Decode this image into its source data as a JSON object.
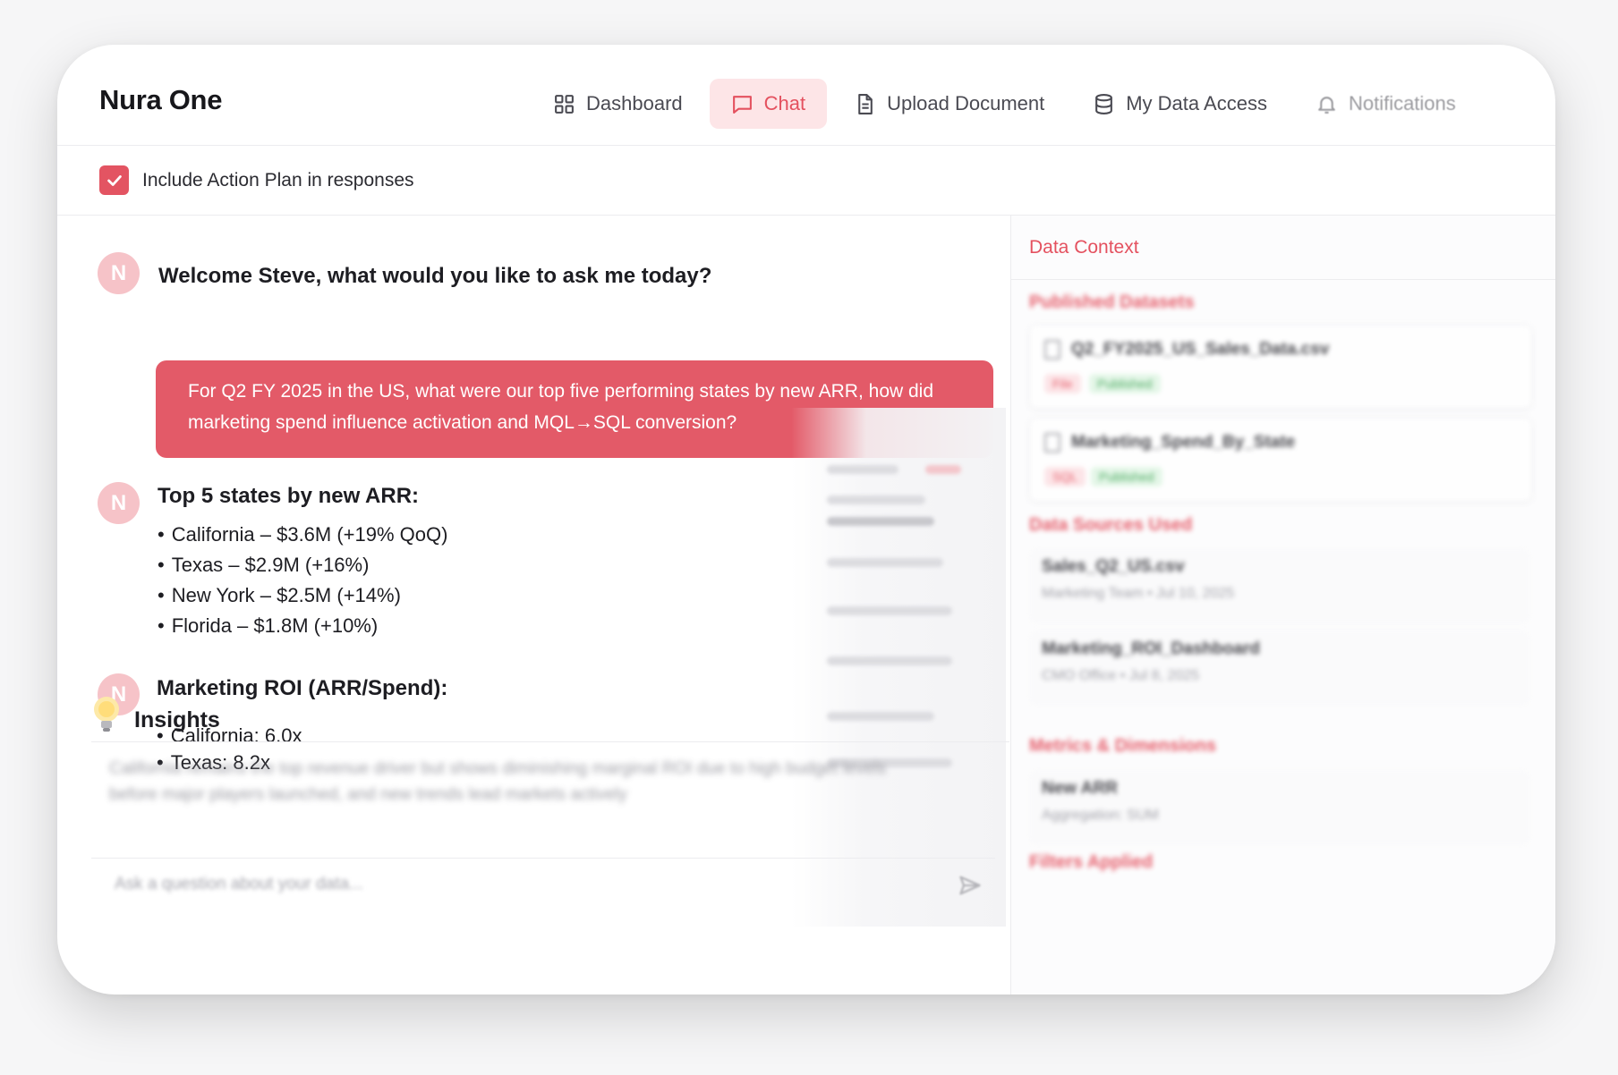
{
  "app": {
    "title": "Nura One"
  },
  "nav": [
    {
      "label": "Dashboard",
      "icon": "dashboard-icon",
      "active": false
    },
    {
      "label": "Chat",
      "icon": "chat-icon",
      "active": true
    },
    {
      "label": "Upload Document",
      "icon": "document-icon",
      "active": false
    },
    {
      "label": "My Data Access",
      "icon": "database-icon",
      "active": false
    },
    {
      "label": "Notifications",
      "icon": "bell-icon",
      "active": false
    }
  ],
  "toolbar": {
    "action_plan_label": "Include Action Plan in responses",
    "action_plan_checked": true
  },
  "chat": {
    "assistant_avatar": "N",
    "welcome": "Welcome Steve, what would you like to ask me today?",
    "user_message": "For Q2 FY 2025 in the US, what were our top five performing states by new ARR, how did marketing spend influence activation and MQL→SQL conversion?",
    "top_states": {
      "title": "Top 5 states by new ARR:",
      "items": [
        "California – $3.6M (+19% QoQ)",
        "Texas – $2.9M (+16%)",
        "New York – $2.5M (+14%)",
        "Florida – $1.8M (+10%)"
      ]
    },
    "roi": {
      "title": "Marketing ROI (ARR/Spend):",
      "items": [
        "California: 6.0x",
        "Texas: 8.2x"
      ]
    },
    "insights": {
      "title": "Insights",
      "text": "California remains the top revenue driver but shows diminishing marginal ROI due to high budget levels before major players launched, and new trends lead markets actively"
    },
    "composer_placeholder": "Ask a question about your data..."
  },
  "context": {
    "title": "Data Context",
    "published_title": "Published Datasets",
    "datasets": [
      {
        "name": "Q2_FY2025_US_Sales_Data.csv",
        "type": "File",
        "status": "Published"
      },
      {
        "name": "Marketing_Spend_By_State",
        "type": "SQL",
        "status": "Published"
      }
    ],
    "sources_title": "Data Sources Used",
    "sources": [
      {
        "name": "Sales_Q2_US.csv",
        "meta": "Marketing Team • Jul 10, 2025"
      },
      {
        "name": "Marketing_ROI_Dashboard",
        "meta": "CMO Office • Jul 8, 2025"
      }
    ],
    "metrics_title": "Metrics & Dimensions",
    "metric": {
      "name": "New ARR",
      "meta": "Aggregation: SUM"
    },
    "filters_title": "Filters Applied"
  },
  "colors": {
    "accent": "#e35462",
    "accent_soft": "#fde5e7",
    "avatar": "#f6c3c8",
    "published_green": "#3fa556"
  }
}
